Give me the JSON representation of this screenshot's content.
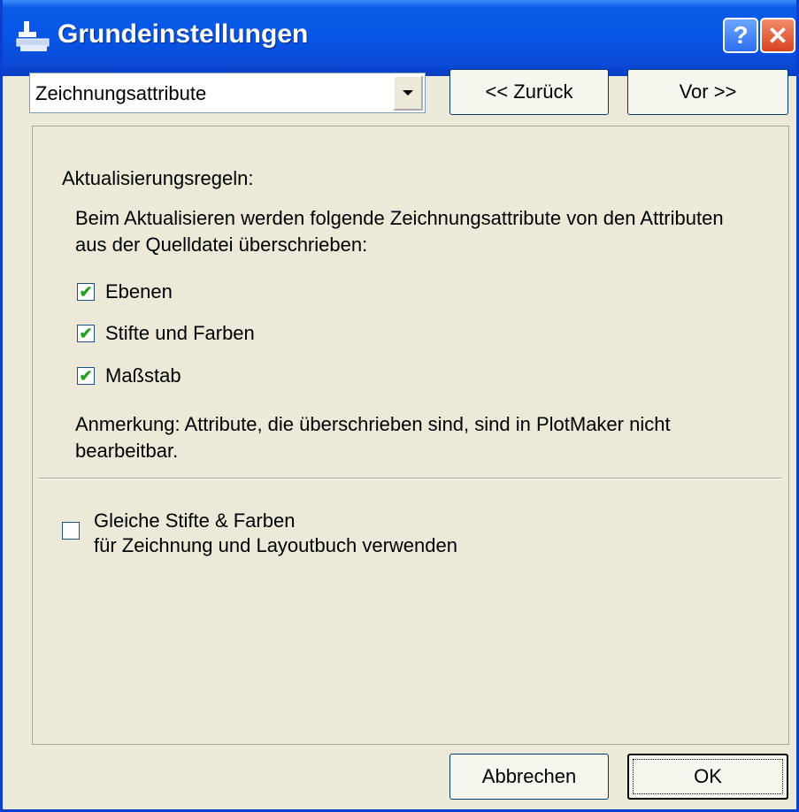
{
  "window": {
    "title": "Grundeinstellungen",
    "help_label": "?",
    "close_label": "✕"
  },
  "navigation": {
    "combo_value": "Zeichnungsattribute",
    "back_label": "<< Zurück",
    "next_label": "Vor >>"
  },
  "content": {
    "heading": "Aktualisierungsregeln:",
    "description": "Beim Aktualisieren werden folgende Zeichnungsattribute von den Attributen aus der Quelldatei überschrieben:",
    "checkboxes": [
      {
        "label": "Ebenen",
        "checked": true
      },
      {
        "label": "Stifte und Farben",
        "checked": true
      },
      {
        "label": "Maßstab",
        "checked": true
      }
    ],
    "note": "Anmerkung: Attribute, die überschrieben sind, sind in PlotMaker nicht bearbeitbar.",
    "same_pens_line1": "Gleiche Stifte & Farben",
    "same_pens_line2": "für Zeichnung und Layoutbuch verwenden",
    "same_pens_checked": false
  },
  "footer": {
    "cancel_label": "Abbrechen",
    "ok_label": "OK"
  },
  "colors": {
    "titlebar": "#0755e6",
    "dialog_bg": "#ece9d8",
    "close_red": "#d9431e",
    "check_green": "#21a121"
  },
  "icons": {
    "app": "plotter-icon",
    "help": "help-icon",
    "close": "close-icon",
    "dropdown": "chevron-down-icon",
    "check": "checkmark-icon"
  }
}
